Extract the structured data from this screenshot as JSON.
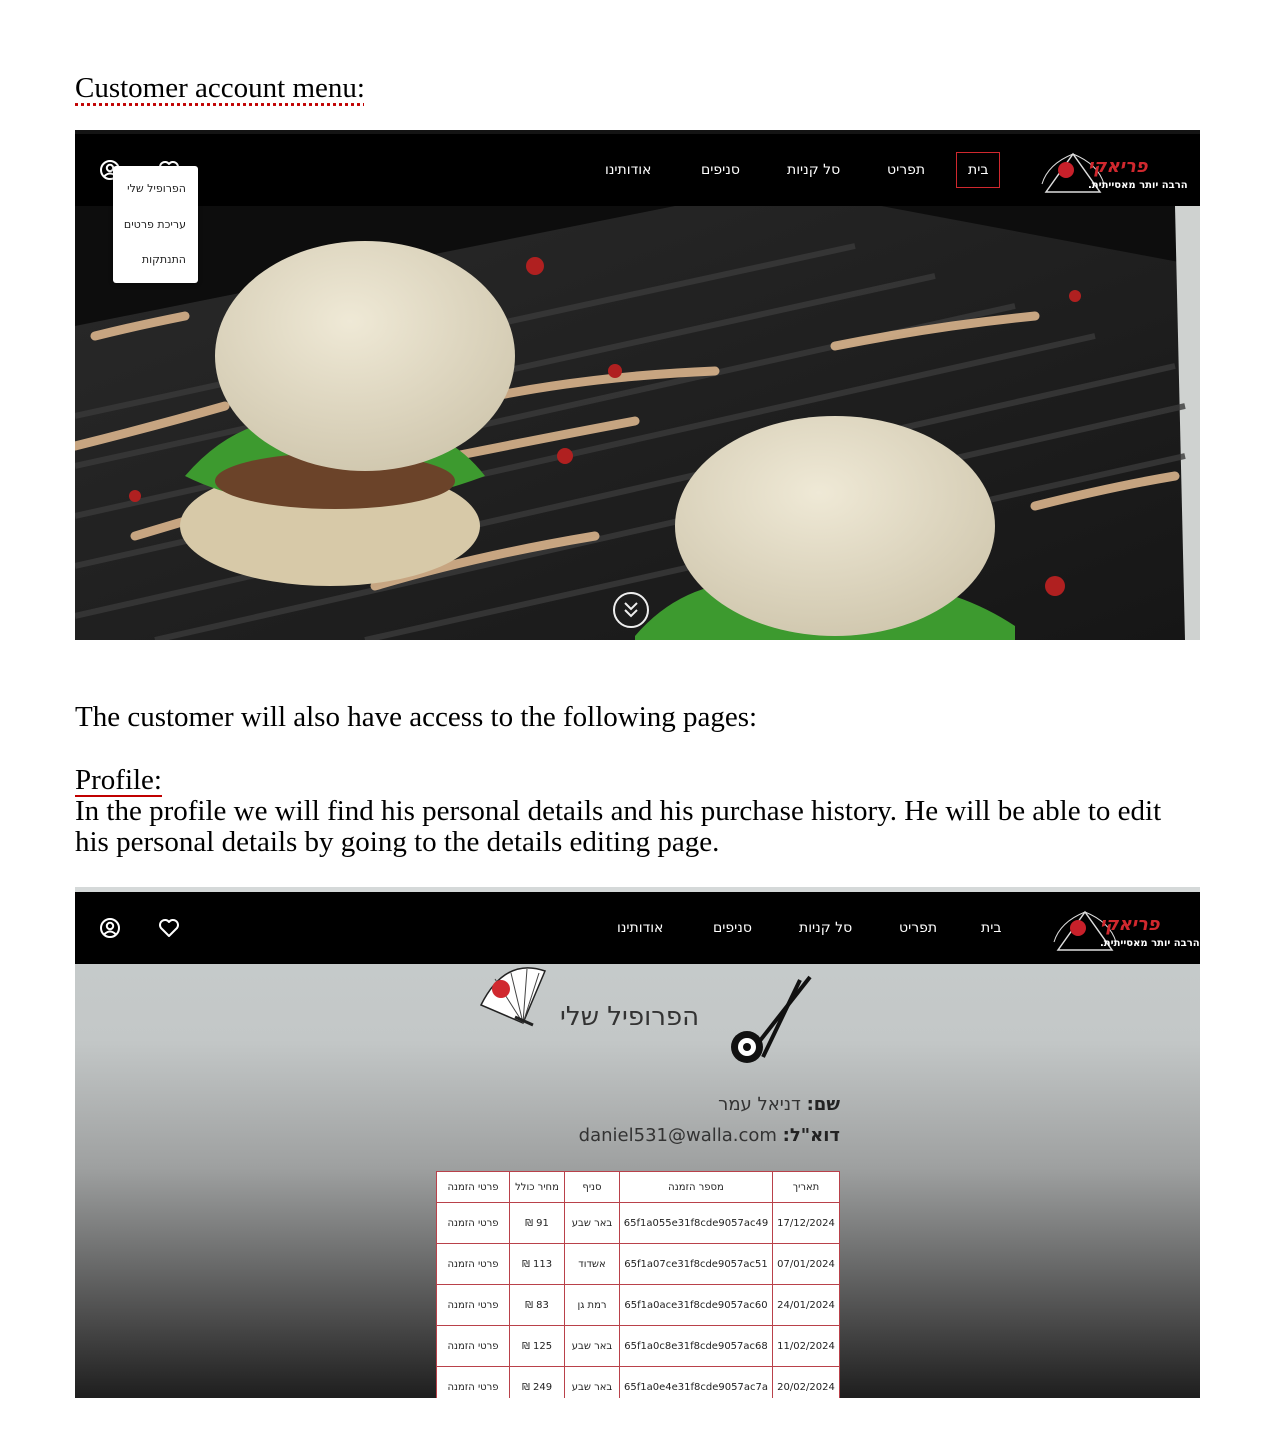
{
  "doc": {
    "menu_heading": "Customer account menu:",
    "access_text": "The customer will also have access to the following pages:",
    "profile_heading": "Profile:",
    "profile_text": "In the profile we will find his personal details and his purchase history. He will be able to edit his personal details by going to the details editing page."
  },
  "site": {
    "nav": {
      "home": "בית",
      "menu": "תפריט",
      "cart": "סל קניות",
      "branches": "סניפים",
      "about": "אודותינו"
    },
    "logo_tagline": "הרבה יותר מאסייתית.",
    "logo_mark": "פריאקי"
  },
  "account_menu": {
    "items": [
      "הפרופיל שלי",
      "עריכת פרטים",
      "התנתקות"
    ]
  },
  "profile": {
    "title": "הפרופיל שלי",
    "name_label": "שם:",
    "name_value": "דניאל עמר",
    "email_label": "דוא\"ל:",
    "email_value": "daniel531@walla.com",
    "table": {
      "headers": [
        "תאריך",
        "מספר הזמנה",
        "סניף",
        "מחיר כולל",
        "פרטי הזמנה"
      ],
      "rows": [
        [
          "17/12/2024",
          "65f1a055e31f8cde9057ac49",
          "באר שבע",
          "91 ₪",
          "פרטי הזמנה"
        ],
        [
          "07/01/2024",
          "65f1a07ce31f8cde9057ac51",
          "אשדוד",
          "113 ₪",
          "פרטי הזמנה"
        ],
        [
          "24/01/2024",
          "65f1a0ace31f8cde9057ac60",
          "רמת גן",
          "83 ₪",
          "פרטי הזמנה"
        ],
        [
          "11/02/2024",
          "65f1a0c8e31f8cde9057ac68",
          "באר שבע",
          "125 ₪",
          "פרטי הזמנה"
        ],
        [
          "20/02/2024",
          "65f1a0e4e31f8cde9057ac7a",
          "באר שבע",
          "249 ₪",
          "פרטי הזמנה"
        ]
      ]
    }
  },
  "icons": {
    "user": "user-circle-icon",
    "favorites": "heart-icon",
    "scroll": "double-chevron-down-icon",
    "fan": "japanese-fan-icon",
    "chopsticks": "chopsticks-sushi-icon"
  },
  "colors": {
    "accent": "#d0282e",
    "navbar": "#000000"
  }
}
